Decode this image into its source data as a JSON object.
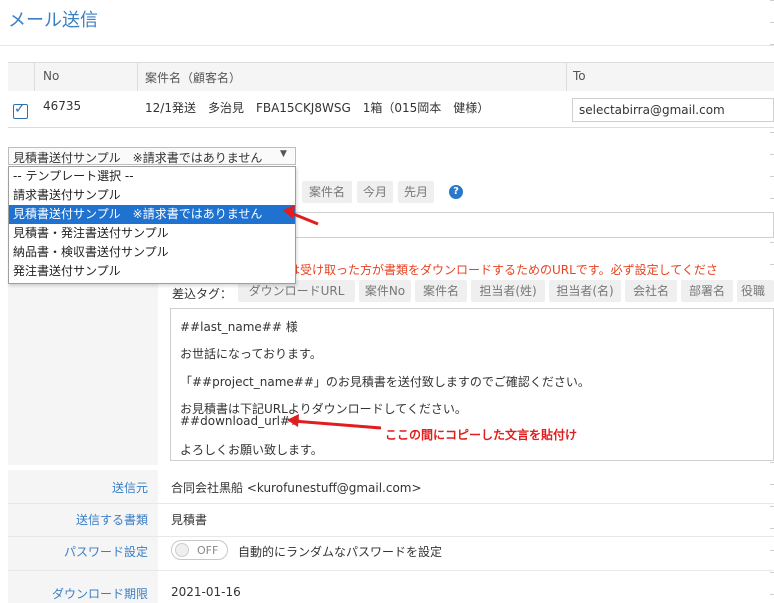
{
  "page": {
    "title": "メール送信"
  },
  "table": {
    "headers": {
      "no": "No",
      "project": "案件名（顧客名）",
      "to": "To"
    },
    "row": {
      "checked": true,
      "no": "46735",
      "project": "12/1発送　多治見　FBA15CKJ8WSG　1箱（015岡本　健様）",
      "to_value": "selectabirra@gmail.com"
    }
  },
  "template_select": {
    "selected_label": "見積書送付サンプル　※請求書ではありません",
    "options": [
      "-- テンプレート選択 --",
      "請求書送付サンプル",
      "見積書送付サンプル　※請求書ではありません",
      "見積書・発注書送付サンプル",
      "納品書・検収書送付サンプル",
      "発注書送付サンプル"
    ],
    "selected_index": 2
  },
  "subject_tags": [
    "案件名",
    "今月",
    "先月"
  ],
  "help_icon": "question-circle-icon",
  "notice_text": "は受け取った方が書類をダウンロードするためのURLです。必ず設定してくださ",
  "insert_tags": {
    "label": "差込タグ：",
    "tags": [
      "ダウンロードURL",
      "案件No",
      "案件名",
      "担当者(姓)",
      "担当者(名)",
      "会社名",
      "部署名",
      "役職"
    ]
  },
  "body_lines": [
    "##last_name## 様",
    "お世話になっております。",
    "「##project_name##」のお見積書を送付致しますのでご確認ください。",
    "お見積書は下記URLよりダウンロードしてください。",
    "##download_url##",
    "よろしくお願い致します。"
  ],
  "annotation_text": "ここの間にコピーした文言を貼付け",
  "form": {
    "sender_label": "送信元",
    "sender_value": "合同会社黒船 <kurofunestuff@gmail.com>",
    "doctype_label": "送信する書類",
    "doctype_value": "見積書",
    "password_label": "パスワード設定",
    "toggle_text": "OFF",
    "password_desc": "自動的にランダムなパスワードを設定",
    "expiry_label": "ダウンロード期限",
    "expiry_value": "2021-01-16"
  },
  "colors": {
    "accent": "#3a7ec6",
    "selected": "#1f72d0",
    "warning": "#e8421e",
    "annotation": "#e21d1d"
  }
}
